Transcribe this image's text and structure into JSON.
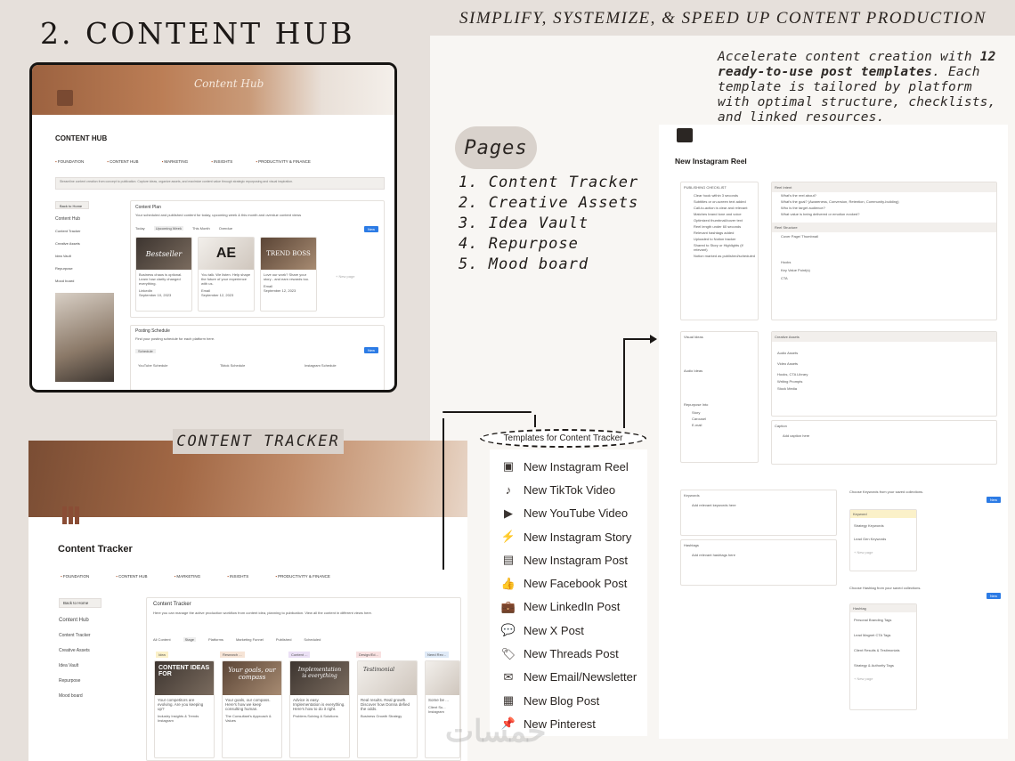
{
  "header": {
    "section_title": "2. CONTENT HUB",
    "tagline": "SIMPLIFY, SYSTEMIZE, & SPEED UP CONTENT PRODUCTION"
  },
  "description": {
    "prefix": "Accelerate content creation with ",
    "bold": "12 ready-to-use post templates",
    "suffix": ". Each template is tailored by platform with optimal structure, checklists, and linked resources."
  },
  "pages": {
    "label": "Pages",
    "items": [
      "1. Content Tracker",
      "2. Creative Assets",
      "3. Idea Vault",
      "4. Repurpose",
      "5. Mood board"
    ]
  },
  "hub_screenshot": {
    "cover_script": "Content Hub",
    "title": "CONTENT HUB",
    "nav": [
      "FOUNDATION",
      "CONTENT HUB",
      "MARKETING",
      "INSIGHTS",
      "PRODUCTIVITY & FINANCE"
    ],
    "intro": "Streamline content creation from concept to publication. Capture ideas, organize assets, and maximize content value through strategic repurposing and visual inspiration.",
    "back": "Back to Home",
    "side_title": "Content Hub",
    "side_items": [
      "Content Tracker",
      "Creative Assets",
      "Idea Vault",
      "Repurpose",
      "Mood board"
    ],
    "plan_title": "Content Plan",
    "plan_sub": "Your scheduled and published content for today, upcoming week & this month and overdue content views",
    "plan_tabs": [
      "Today",
      "Upcoming Week",
      "This Month",
      "Overdue"
    ],
    "new": "New",
    "cards": [
      {
        "img_text": "Bestseller",
        "text": "Business chaos is optional. Learn how clarity changed everything.",
        "tag": "LinkedIn",
        "date": "September 10, 2023"
      },
      {
        "img_text": "AE",
        "text": "You talk. We listen. Help shape the future of your experience with us.",
        "tag": "Email",
        "date": "September 12, 2023"
      },
      {
        "img_text": "TREND BOSS",
        "text": "Love our work? Share your story - and earn rewards too.",
        "tag": "Email",
        "date": "September 12, 2023"
      }
    ],
    "new_page": "+ New page",
    "posting_title": "Posting Schedule",
    "posting_sub": "Find your posting schedule for each platform here.",
    "posting_tab": "Schedule",
    "schedules": [
      "YouTube Schedule",
      "Tiktok Schedule",
      "Instagram Schedule"
    ]
  },
  "tracker_label": "CONTENT TRACKER",
  "tracker_screenshot": {
    "title": "Content Tracker",
    "nav": [
      "FOUNDATION",
      "CONTENT HUB",
      "MARKETING",
      "INSIGHTS",
      "PRODUCTIVITY & FINANCE"
    ],
    "back": "Back to Home",
    "side_title": "Content Hub",
    "side_items": [
      "Content Tracker",
      "Creative Assets",
      "Idea Vault",
      "Repurpose",
      "Mood board"
    ],
    "panel_title": "Content Tracker",
    "panel_sub": "Here you can manage the active production workflow from content idea, planning to publication. View all the content in different views here.",
    "tabs": [
      "All Content",
      "Stage",
      "Platforms",
      "Marketing Funnel",
      "Published",
      "Scheduled"
    ],
    "columns": [
      "Idea",
      "Research ...",
      "Content ...",
      "Design/Ed...",
      "Need Rev..."
    ],
    "cards": [
      {
        "img_text": "CONTENT IDEAS FOR",
        "text": "Your competitors are evolving. Are you keeping up?",
        "tag": "Industry Insights & Trends",
        "platform": "Instagram"
      },
      {
        "img_text": "Your goals, our compass",
        "text": "Your goals, our compass. Here's how we keep consulting human.",
        "tag": "The Consultant's Approach & Values",
        "platform": ""
      },
      {
        "img_text": "Implementation is everything",
        "text": "Advice is easy. Implementation is everything. Here's how to do it right.",
        "tag": "Problem-Solving & Solutions",
        "platform": ""
      },
      {
        "img_text": "Testimonial",
        "text": "Real results. Real growth. Discover how Donna defied the odds.",
        "tag": "Business Growth Strategy",
        "platform": ""
      },
      {
        "img_text": "",
        "text": "Some be ...",
        "tag": "Client Su...",
        "platform": "Instagram"
      }
    ]
  },
  "templates": {
    "label": "Templates for  Content Tracker",
    "items": [
      {
        "icon": "reel-icon",
        "glyph": "▣",
        "label": "New Instagram Reel"
      },
      {
        "icon": "tiktok-icon",
        "glyph": "♪",
        "label": "New TikTok Video"
      },
      {
        "icon": "youtube-icon",
        "glyph": "▶",
        "label": "New YouTube Video"
      },
      {
        "icon": "story-icon",
        "glyph": "⚡",
        "label": "New Instagram Story"
      },
      {
        "icon": "post-icon",
        "glyph": "▤",
        "label": "New Instagram Post"
      },
      {
        "icon": "facebook-icon",
        "glyph": "👍",
        "label": "New Facebook Post"
      },
      {
        "icon": "linkedin-icon",
        "glyph": "💼",
        "label": "New LinkedIn Post"
      },
      {
        "icon": "x-icon",
        "glyph": "💬",
        "label": "New X Post"
      },
      {
        "icon": "threads-icon",
        "glyph": "🏷",
        "label": "New Threads Post"
      },
      {
        "icon": "email-icon",
        "glyph": "✉",
        "label": "New Email/Newsletter"
      },
      {
        "icon": "blog-icon",
        "glyph": "▦",
        "label": "New Blog Post"
      },
      {
        "icon": "pinterest-icon",
        "glyph": "📌",
        "label": "New Pinterest"
      }
    ]
  },
  "reel_screenshot": {
    "title": "New Instagram Reel",
    "checklist_title": "PUBLISHING CHECKLIST",
    "checklist": [
      "Clear hook within 3 seconds",
      "Subtitles or on-screen text added",
      "Call-to-action is clear and relevant",
      "Matches brand tone and voice",
      "Optimized thumbnail/cover text",
      "Reel length under 60 seconds",
      "Relevant hashtags added",
      "Uploaded to Notion tracker",
      "Shared to Story or Highlights (if relevant)",
      "Notion marked as published/scheduled"
    ],
    "intent_title": "Reel Intent",
    "intent": [
      "What's the reel about?",
      "What's the goal? (Awareness, Conversion, Retention, Community-building)",
      "Who is the target audience?",
      "What value is being delivered or emotion evoked?"
    ],
    "structure_title": "Reel Structure",
    "structure": [
      "Cover Page/ Thumbnail",
      "Hooks",
      "Key Value Point(s)",
      "CTA"
    ],
    "visual_title": "Visual Ideas",
    "audio_title": "Audio Ideas",
    "repurpose_title": "Repurpose Into",
    "repurpose": [
      "Story",
      "Carousel",
      "E-mail"
    ],
    "assets_title": "Creative Assets",
    "assets": [
      "Audio Assets",
      "Video Assets",
      "Hooks, CTA Library",
      "Writing Prompts",
      "Stock Media"
    ],
    "caption_title": "Caption",
    "caption_placeholder": "Add caption here"
  },
  "reel_bottom": {
    "keywords_title": "Keywords",
    "keywords_placeholder": "Add relevant keywords here",
    "hashtags_title": "Hashtags",
    "hashtags_placeholder": "Add relevant hashtags here",
    "kw_choose": "Choose Keywords from your saved collections.",
    "kw_group": "Keyword",
    "kw_items": [
      "Strategy Keywords",
      "Lead Gen Keywords"
    ],
    "ht_choose": "Choose Hashtag from your saved collections.",
    "ht_group": "Hashtag",
    "ht_items": [
      "Personal Branding Tags",
      "Lead Magnet CTA Tags",
      "Client Results & Testimonials",
      "Strategy & Authority Tags"
    ],
    "new_page": "+ New page"
  },
  "watermark": "خمسات"
}
